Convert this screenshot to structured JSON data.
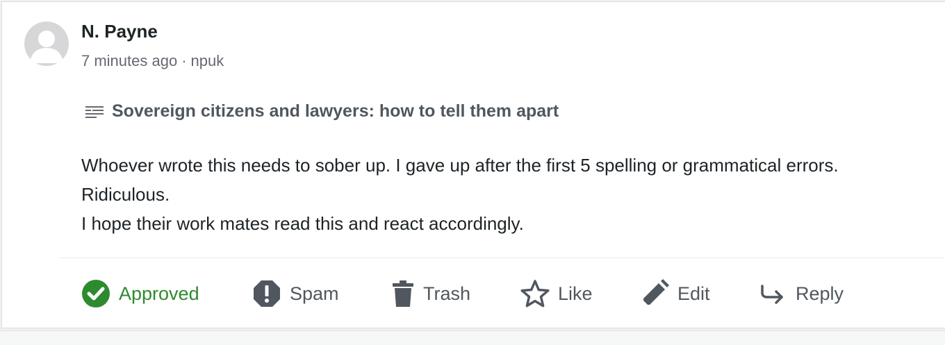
{
  "comment": {
    "author": "N. Payne",
    "time": "7 minutes ago",
    "separator": "·",
    "username": "npuk",
    "post_title": "Sovereign citizens and lawyers: how to tell them apart",
    "body_lines": [
      "Whoever wrote this needs to sober up. I gave up after the first 5 spelling or grammatical errors.",
      "Ridiculous.",
      "I hope their work mates read this and react accordingly."
    ]
  },
  "actions": {
    "approved_label": "Approved",
    "spam_label": "Spam",
    "trash_label": "Trash",
    "like_label": "Like",
    "edit_label": "Edit",
    "reply_label": "Reply"
  },
  "icons": {
    "avatar": "default-avatar-icon",
    "post": "post-lines-icon",
    "approved": "check-circle-icon",
    "spam": "exclamation-octagon-icon",
    "trash": "trash-icon",
    "like": "star-outline-icon",
    "edit": "pencil-icon",
    "reply": "reply-arrow-icon"
  },
  "colors": {
    "approved": "#2e8a2e",
    "text": "#1d2327",
    "muted": "#646970",
    "action": "#50575e"
  }
}
